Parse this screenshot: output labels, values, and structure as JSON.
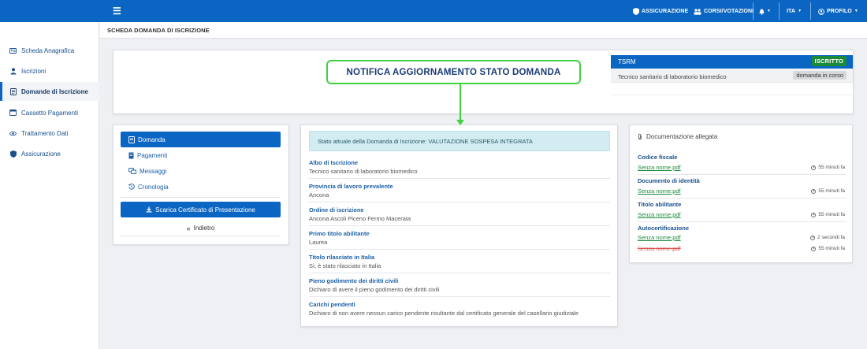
{
  "topbar": {
    "menu_icon": "hamburger-icon",
    "assicurazione": "ASSICURAZIONE",
    "corsi": "CORSI/VOTAZIONI",
    "lang": "ITA",
    "profilo": "PROFILO"
  },
  "sidebar": {
    "items": [
      {
        "label": "Scheda Anagrafica",
        "icon": "id-card-icon"
      },
      {
        "label": "Iscrizioni",
        "icon": "user-icon"
      },
      {
        "label": "Domande di Iscrizione",
        "icon": "form-icon"
      },
      {
        "label": "Cassetto Pagamenti",
        "icon": "folder-icon"
      },
      {
        "label": "Trattamento Dati",
        "icon": "eye-icon"
      },
      {
        "label": "Assicurazione",
        "icon": "shield-icon"
      }
    ]
  },
  "header": {
    "title": "SCHEDA DOMANDA DI ISCRIZIONE"
  },
  "annotation": {
    "text": "NOTIFICA AGGIORNAMENTO STATO DOMANDA"
  },
  "profile_box": {
    "code": "TSRM",
    "status": "ISCRITTO",
    "description": "Tecnico sanitario di laboratorio biomedico",
    "badge": "domanda in corso"
  },
  "menu": {
    "items": [
      "Domanda",
      "Pagamenti",
      "Messaggi",
      "Cronologia"
    ],
    "download": "Scarica Certificato di Presentazione",
    "back": "Indietro"
  },
  "domanda": {
    "status": "Stato attuale della Domanda di Iscrizione: VALUTAZIONE SOSPESA INTEGRATA",
    "fields": [
      {
        "label": "Albo di Iscrizione",
        "value": "Tecnico sanitario di laboratorio biomedico"
      },
      {
        "label": "Provincia di lavoro prevalente",
        "value": "Ancona"
      },
      {
        "label": "Ordine di iscrizione",
        "value": "Ancona Ascoli Piceno Fermo Macerata"
      },
      {
        "label": "Primo titolo abilitante",
        "value": "Laurea"
      },
      {
        "label": "Titolo rilasciato in Italia",
        "value": "Sì, è stato rilasciato in Italia"
      },
      {
        "label": "Pieno godimento dei diritti civili",
        "value": "Dichiaro di avere il pieno godimento dei diritti civili"
      },
      {
        "label": "Carichi pendenti",
        "value": "Dichiaro di non avere nessun carico pendente risultante dal certificato generale del casellario giudiziale"
      }
    ]
  },
  "documenti": {
    "title": "Documentazione allegata",
    "groups": [
      {
        "label": "Codice fiscale",
        "files": [
          {
            "name": "Senza nome.pdf",
            "time": "55 minuti fa"
          }
        ]
      },
      {
        "label": "Documento di identità",
        "files": [
          {
            "name": "Senza nome.pdf",
            "time": "55 minuti fa"
          }
        ]
      },
      {
        "label": "Titolo abilitante",
        "files": [
          {
            "name": "Senza nome.pdf",
            "time": "55 minuti fa"
          }
        ]
      },
      {
        "label": "Autocertificazione",
        "files": [
          {
            "name": "Senza nome.pdf",
            "time": "2 secondi fa"
          },
          {
            "name": "Senza nome.pdf",
            "time": "55 minuti fa",
            "deleted": true
          }
        ]
      }
    ]
  }
}
